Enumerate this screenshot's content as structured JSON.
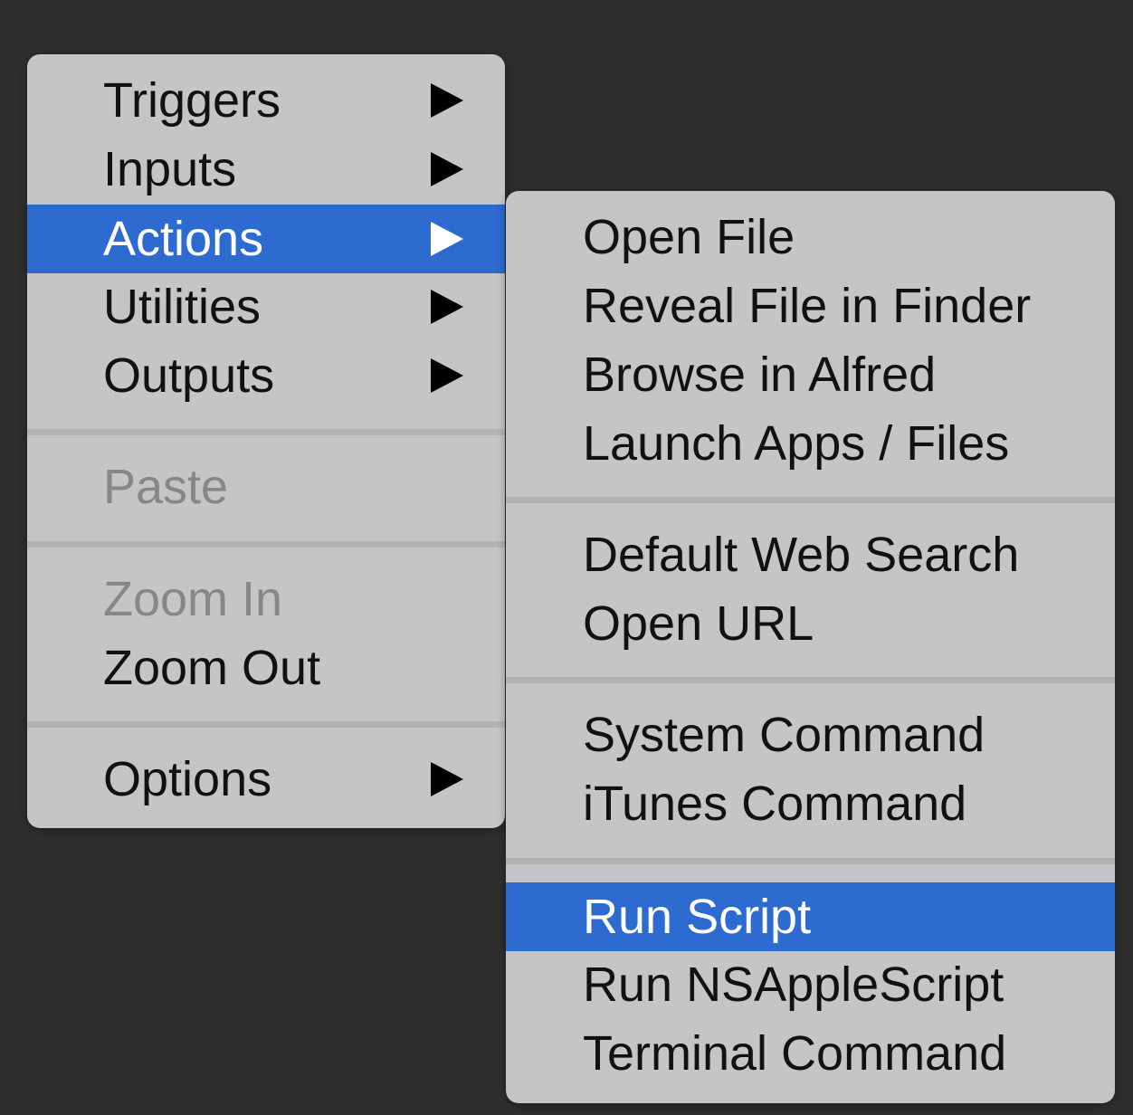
{
  "main_menu": {
    "items": [
      {
        "label": "Triggers"
      },
      {
        "label": "Inputs"
      },
      {
        "label": "Actions"
      },
      {
        "label": "Utilities"
      },
      {
        "label": "Outputs"
      },
      {
        "label": "Paste"
      },
      {
        "label": "Zoom In"
      },
      {
        "label": "Zoom Out"
      },
      {
        "label": "Options"
      }
    ]
  },
  "actions_submenu": {
    "items": [
      {
        "label": "Open File"
      },
      {
        "label": "Reveal File in Finder"
      },
      {
        "label": "Browse in Alfred"
      },
      {
        "label": "Launch Apps / Files"
      },
      {
        "label": "Default Web Search"
      },
      {
        "label": "Open URL"
      },
      {
        "label": "System Command"
      },
      {
        "label": "iTunes Command"
      },
      {
        "label": "Run Script"
      },
      {
        "label": "Run NSAppleScript"
      },
      {
        "label": "Terminal Command"
      }
    ]
  },
  "icons": {
    "submenu_arrow": "triangle-right-icon"
  },
  "colors": {
    "background": "#2e2e2e",
    "menu_background": "#c5c5c5",
    "highlight": "#2d6bd1",
    "disabled_text": "#878787"
  }
}
